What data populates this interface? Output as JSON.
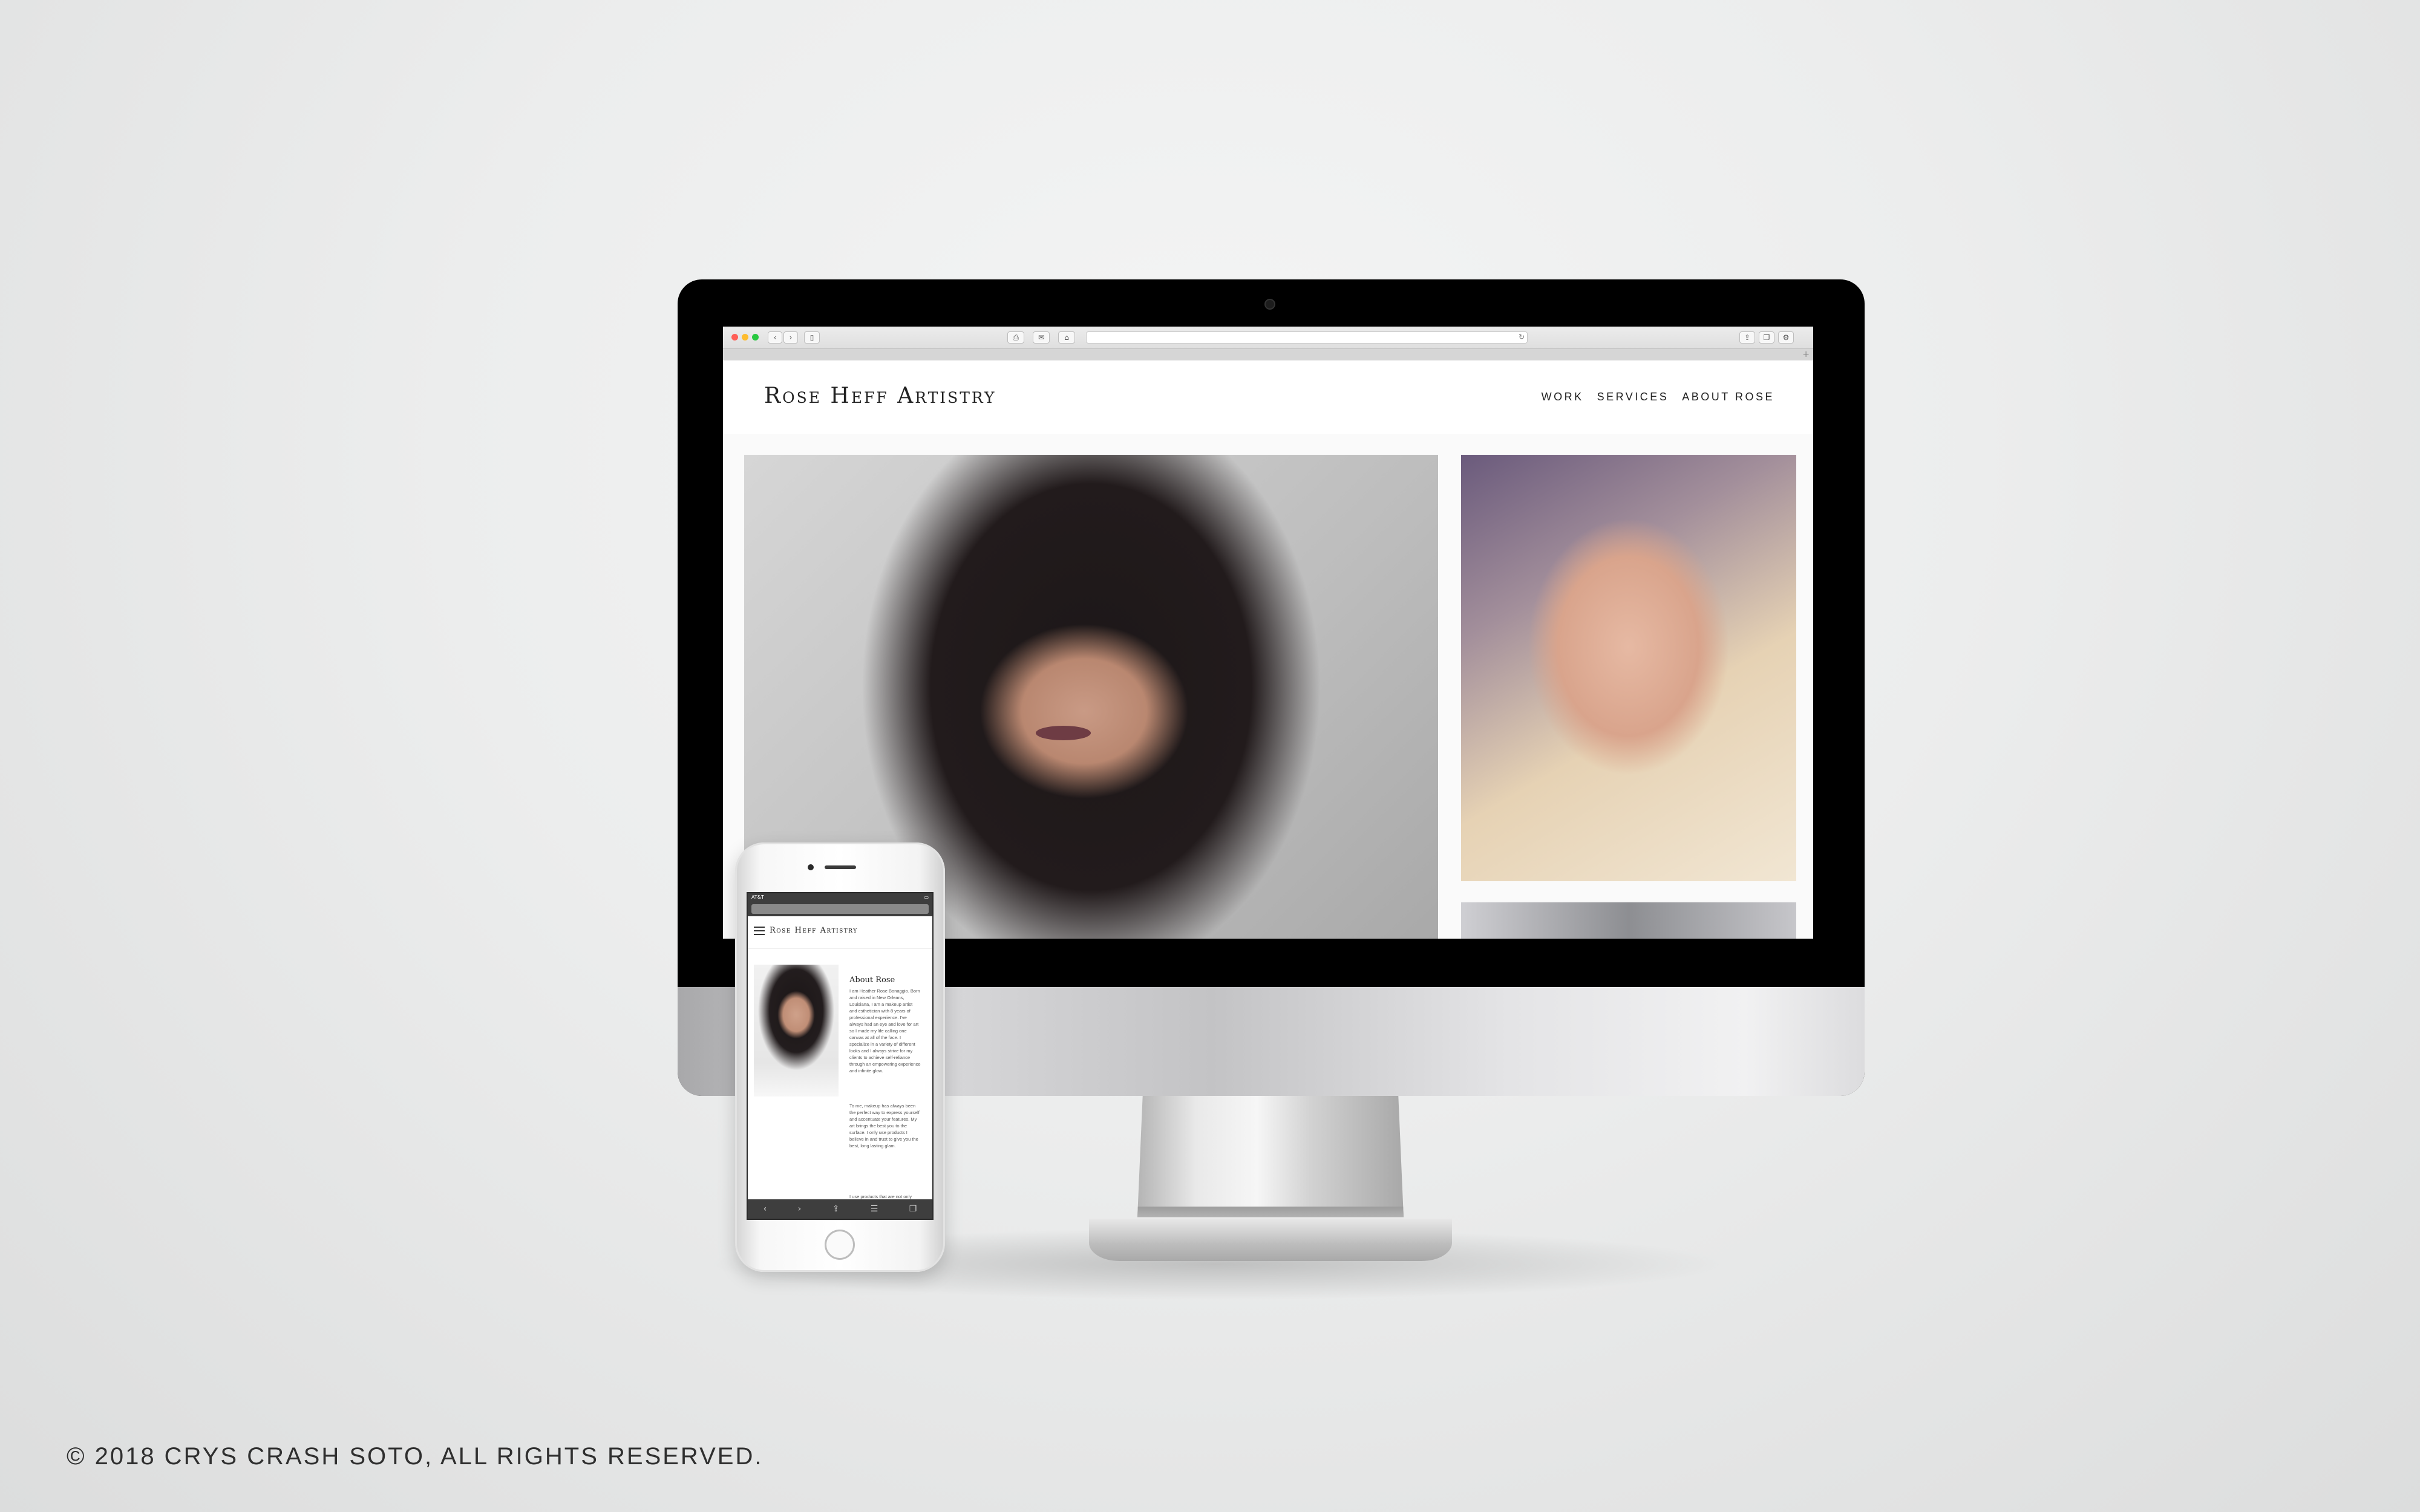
{
  "desktop": {
    "site_title": "Rose Heff Artistry",
    "nav": [
      "WORK",
      "SERVICES",
      "ABOUT ROSE"
    ]
  },
  "browser": {
    "back_icon": "chevron-left-icon",
    "forward_icon": "chevron-right-icon",
    "sidebar_icon": "sidebar-icon",
    "print_icon": "print-icon",
    "mail_icon": "mail-icon",
    "home_icon": "home-icon",
    "reload_icon": "reload-icon",
    "share_icon": "share-icon",
    "tabs_icon": "tabs-icon",
    "settings_icon": "gear-icon",
    "new_tab_icon": "plus-icon"
  },
  "mobile": {
    "status_carrier": "AT&T",
    "site_title": "Rose Heff Artistry",
    "about_title": "About Rose",
    "paragraph_1": "I am Heather Rose Bonaggio. Born and raised in New Orleans, Louisiana, I am a makeup artist and esthetician with 8 years of professional experience. I've always had an eye and love for art so I made my life calling one canvas at all of the face. I specialize in a variety of different looks and I always strive for my clients to achieve self-reliance through an empowering experience and infinite glow.",
    "paragraph_2": "To me, makeup has always been the perfect way to express yourself and accentuate your features. My art brings the best you to the surface. I only use products I believe in and trust to give you the best, long lasting glam.",
    "paragraph_3": "I use products that are not only"
  },
  "footer": {
    "copyright": "© 2018 CRYS CRASH SOTO, ALL RIGHTS RESERVED."
  }
}
